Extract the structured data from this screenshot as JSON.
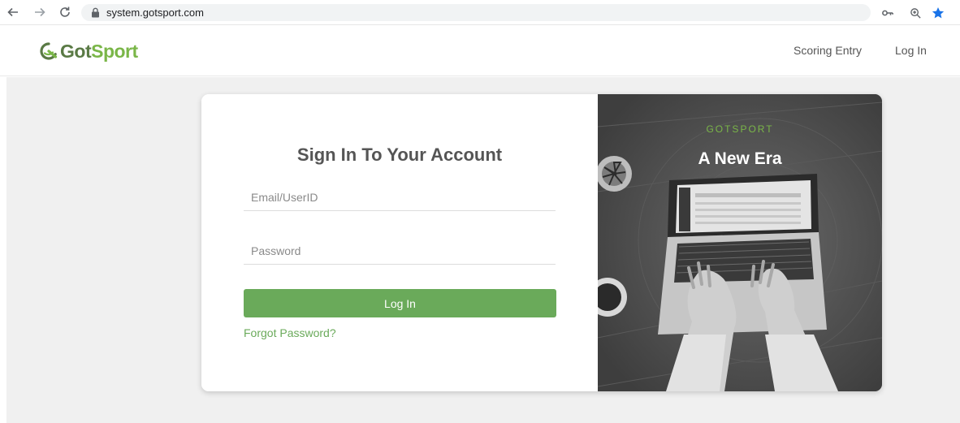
{
  "browser": {
    "url": "system.gotsport.com",
    "icons": {
      "back": "back-arrow-icon",
      "forward": "forward-arrow-icon",
      "reload": "reload-icon",
      "lock": "lock-icon",
      "key": "key-icon",
      "zoom": "zoom-icon",
      "bookmark": "star-icon"
    }
  },
  "header": {
    "logo": {
      "got": "Got",
      "sport": "Sport"
    },
    "nav": {
      "scoring_entry": "Scoring Entry",
      "login": "Log In"
    }
  },
  "login": {
    "title": "Sign In To Your Account",
    "email_placeholder": "Email/UserID",
    "password_placeholder": "Password",
    "email_value": "",
    "password_value": "",
    "submit_label": "Log In",
    "forgot_label": "Forgot Password?"
  },
  "promo": {
    "brand": "GOTSPORT",
    "headline": "A New Era"
  },
  "colors": {
    "accent_green": "#6aaa5a",
    "logo_dark": "#5a7a45",
    "logo_light": "#7ab648",
    "promo_bg": "#4e4e4e"
  }
}
